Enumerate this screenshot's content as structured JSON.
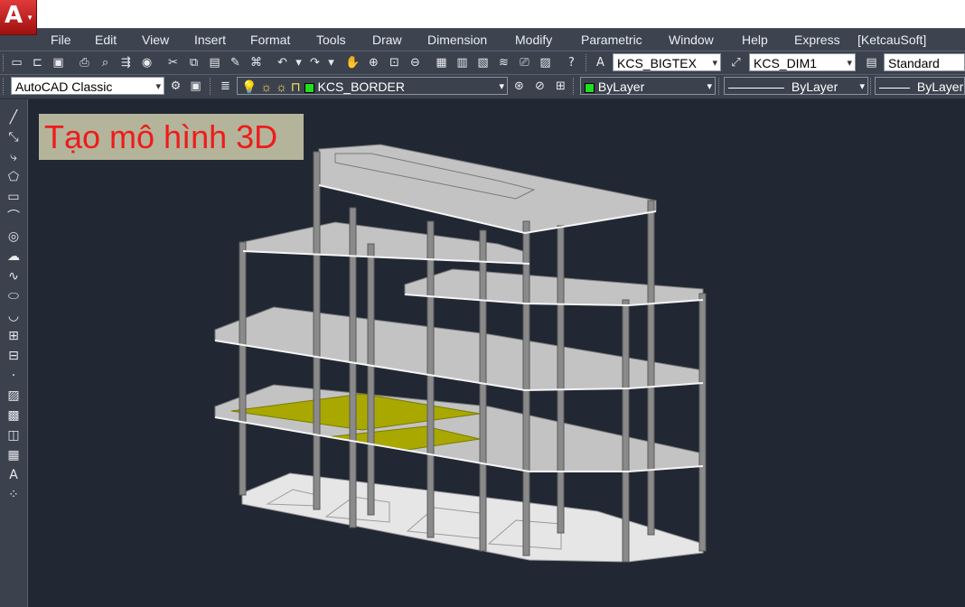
{
  "app": {
    "button_glyph": "A",
    "accent": "#c81e1e"
  },
  "menu": [
    "File",
    "Edit",
    "View",
    "Insert",
    "Format",
    "Tools",
    "Draw",
    "Dimension",
    "Modify",
    "Parametric",
    "Window",
    "Help",
    "Express",
    "[KetcauSoft]"
  ],
  "toolbar1": {
    "text_style": "KCS_BIGTEX",
    "dim_style": "KCS_DIM1",
    "table_style": "Standard"
  },
  "toolbar2": {
    "workspace": "AutoCAD Classic",
    "layer": "KCS_BORDER",
    "color": "ByLayer",
    "linetype": "ByLayer",
    "lineweight": "ByLayer",
    "layer_color": "#22dd22"
  },
  "viewport": {
    "label": "Tạo mô hình 3D",
    "background": "#212833",
    "label_color": "#ee1b1b",
    "highlight_slab_color": "#a8a800"
  }
}
